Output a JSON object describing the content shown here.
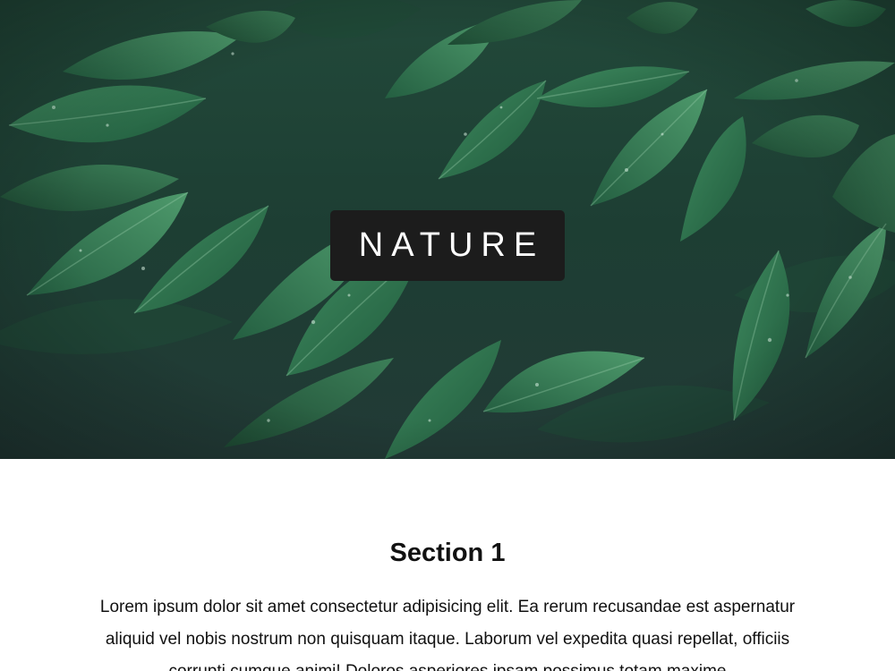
{
  "hero": {
    "label": "NATURE",
    "image": "green-leaves-with-water-drops"
  },
  "section1": {
    "title": "Section 1",
    "body": "Lorem ipsum dolor sit amet consectetur adipisicing elit. Ea rerum recusandae est aspernatur aliquid vel nobis nostrum non quisquam itaque. Laborum vel expedita quasi repellat, officiis corrupti cumque animi! Doloros asperiores ipsam possimus totam maxime"
  },
  "colors": {
    "label_background": "#1c1c1c",
    "label_text": "#ffffff",
    "page_background": "#ffffff",
    "foliage_dark": "#1b3a2c",
    "foliage_mid": "#2f6b4a",
    "foliage_light": "#4f9a6e"
  }
}
